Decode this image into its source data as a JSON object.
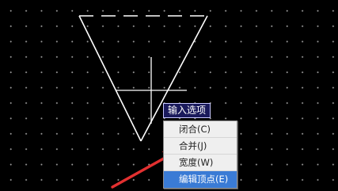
{
  "input_prompt": "输入选项",
  "menu": {
    "items": [
      {
        "label": "闭合(C)",
        "selected": false
      },
      {
        "label": "合并(J)",
        "selected": false
      },
      {
        "label": "宽度(W)",
        "selected": false
      },
      {
        "label": "编辑顶点(E)",
        "selected": true
      }
    ]
  },
  "colors": {
    "background": "#000000",
    "drawing_lines": "#ffffff",
    "arrow": "#e23030",
    "selected_item": "#3a7bd5"
  }
}
